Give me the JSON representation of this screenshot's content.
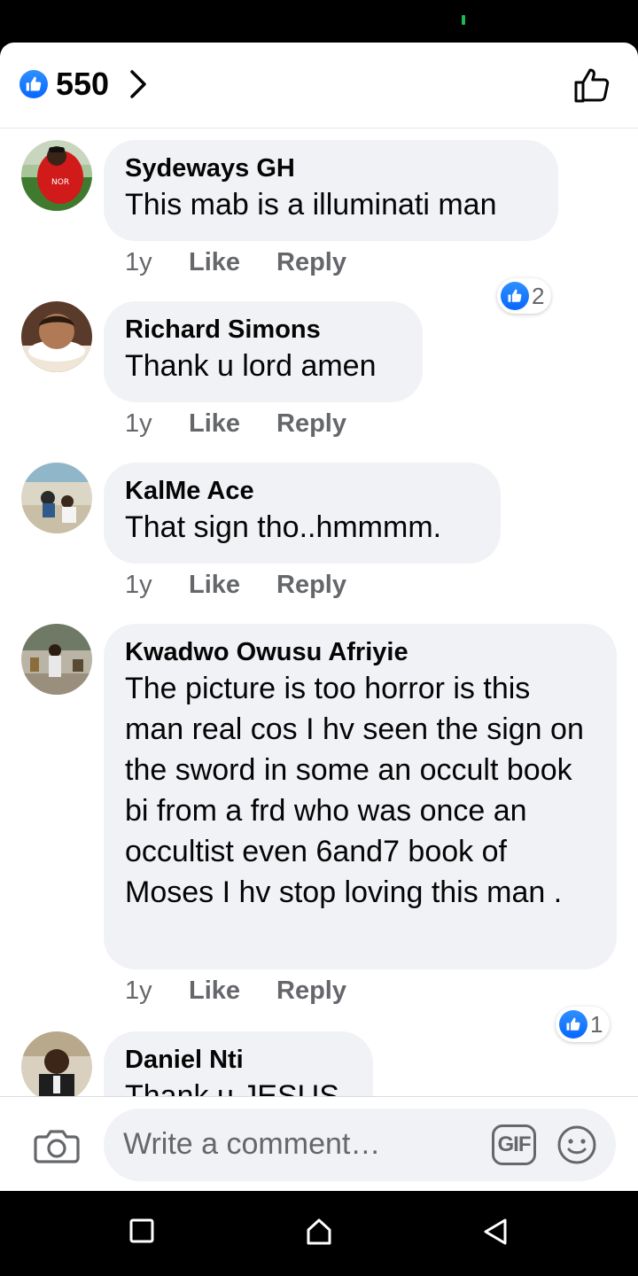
{
  "header": {
    "reaction_count": "550",
    "reaction_icon": "like-reaction-icon",
    "chevron_icon": "chevron-right-icon",
    "like_button_icon": "thumbs-up-outline-icon"
  },
  "comments": [
    {
      "author": "Sydeways GH",
      "text": "This mab is a illuminati man",
      "time": "1y",
      "like_label": "Like",
      "reply_label": "Reply",
      "reactions": "2"
    },
    {
      "author": "Richard Simons",
      "text": "Thank u lord amen",
      "time": "1y",
      "like_label": "Like",
      "reply_label": "Reply"
    },
    {
      "author": "KalMe Ace",
      "text": "That sign tho..hmmmm.",
      "time": "1y",
      "like_label": "Like",
      "reply_label": "Reply"
    },
    {
      "author": "Kwadwo Owusu Afriyie",
      "text": "The picture is too horror is this man real cos I hv seen the sign on the sword in some an occult book bi from a frd who was once an occultist even 6and7 book of Moses I hv stop loving this man .",
      "time": "1y",
      "like_label": "Like",
      "reply_label": "Reply",
      "reactions": "1"
    },
    {
      "author": "Daniel Nti",
      "text": "Thank u JESUS"
    }
  ],
  "composer": {
    "placeholder": "Write a comment…",
    "gif_label": "GIF",
    "camera_icon": "camera-icon",
    "emoji_icon": "smiley-icon"
  },
  "colors": {
    "accent": "#0866ff",
    "bubble": "#f0f2f5",
    "secondary_text": "#65676b"
  }
}
